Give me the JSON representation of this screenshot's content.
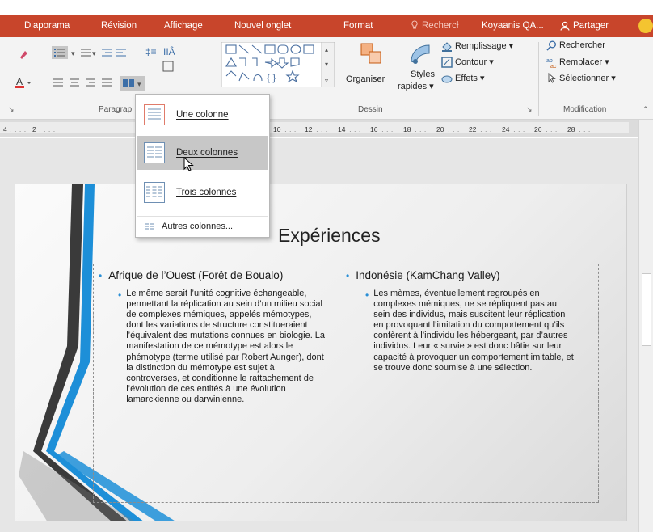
{
  "ribbon_tabs": {
    "diaporama": "Diaporama",
    "revision": "Révision",
    "affichage": "Affichage",
    "nouvel_onglet": "Nouvel onglet",
    "format": "Format",
    "tell_me": "Rechercł",
    "account": "Koyaanis QA...",
    "share": "Partager"
  },
  "ribbon": {
    "paragraph_group": "Paragrap",
    "drawing_group": "Dessin",
    "editing_group": "Modification",
    "arrange_label": "Organiser",
    "styles_label_1": "Styles",
    "styles_label_2": "rapides",
    "fill_label": "Remplissage",
    "outline_label": "Contour",
    "effects_label": "Effets",
    "find_label": "Rechercher",
    "replace_label": "Remplacer",
    "select_label": "Sélectionner"
  },
  "ruler": {
    "numbers": [
      "4",
      "2",
      "10",
      "12",
      "14",
      "16",
      "18",
      "20",
      "22",
      "24",
      "26",
      "28"
    ]
  },
  "columns_menu": {
    "one_column": "Une colonne",
    "two_columns": "Deux colonnes",
    "three_columns": "Trois colonnes",
    "more_columns": "Autres colonnes..."
  },
  "slide": {
    "title": "Expériences",
    "left_heading": "Afrique de l’Ouest (Forêt de Boualo)",
    "left_body": "Le même serait l’unité cognitive échangeable, permettant la réplication au sein d’un milieu social de complexes mémiques, appelés mémotypes, dont les variations de structure constitueraient l’équivalent des mutations connues en biologie. La manifestation de ce mémotype est alors le phémotype (terme utilisé par Robert Aunger), dont la distinction du mémotype est sujet à controverses, et conditionne le rattachement de l’évolution de ces entités à une évolution lamarckienne ou darwinienne.",
    "right_heading": "Indonésie (KamChang Valley)",
    "right_body": "Les mèmes, éventuellement regroupés en complexes mémiques, ne se répliquent pas au sein des individus, mais suscitent leur réplication en provoquant l’imitation du comportement qu’ils confèrent à l’individu les hébergeant, par d’autres individus. Leur « survie » est donc bâtie sur leur capacité à provoquer un comportement imitable, et se trouve donc soumise à une sélection."
  },
  "colors": {
    "ribbon_accent": "#c8452b",
    "bullet": "#2a8fd6",
    "stripe_blue": "#1d8fd8",
    "stripe_dark": "#3a3a3a"
  }
}
